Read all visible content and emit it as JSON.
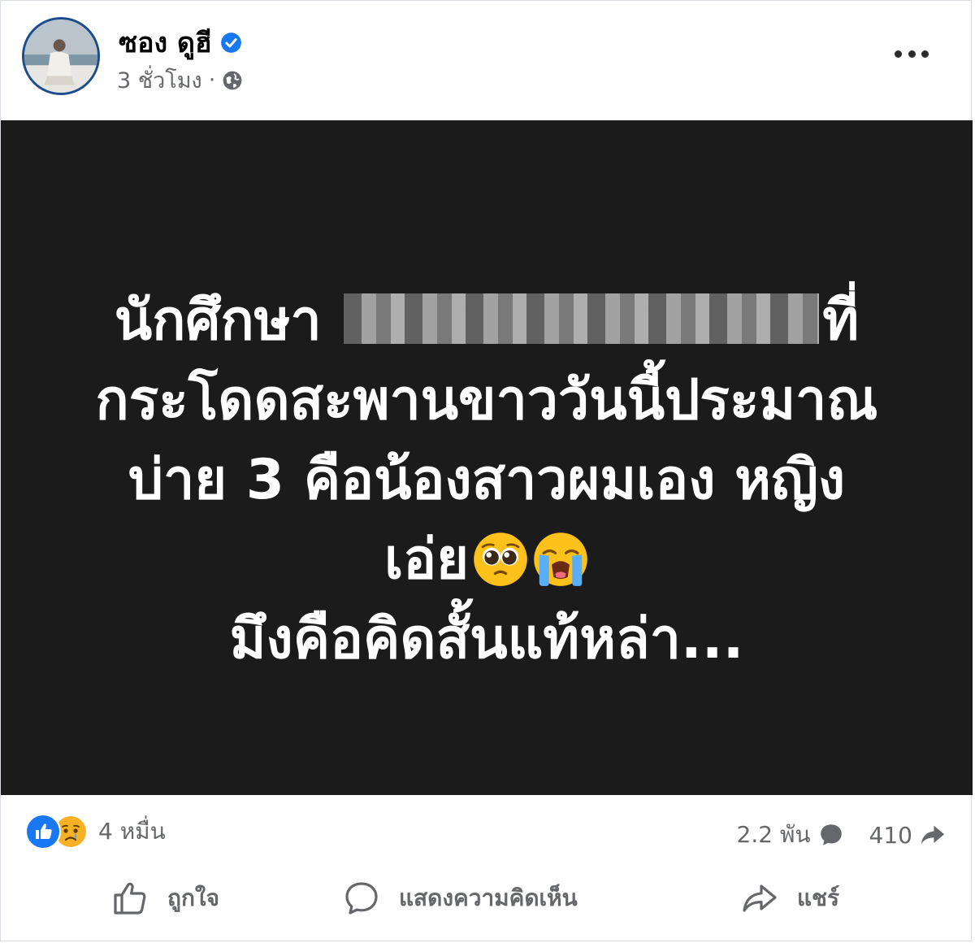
{
  "post": {
    "author": "ซอง ดูฮี",
    "verified": true,
    "time": "3 ชั่วโมง",
    "separator": "·",
    "privacy_icon": "globe-icon",
    "more_icon": "more-options-icon"
  },
  "image": {
    "line1": "นักศึกษา",
    "line1_end": "ที่",
    "line2": "กระโดดสะพานขาววันนี้ประมาณ",
    "line3": "บ่าย 3 คือน้องสาวผมเอง หญิง",
    "line4": "เอ่ย",
    "line5": "มึงคือคิดสั้นแท้หล่า...",
    "emojis": [
      "pleading-face-emoji",
      "loudly-crying-face-emoji"
    ],
    "background": "#1b1b1b"
  },
  "reactions": {
    "icons": [
      "like-reaction-icon",
      "sad-reaction-icon"
    ],
    "count": "4 หมื่น",
    "comments": "2.2 พัน",
    "shares": "410"
  },
  "actions": {
    "like": "ถูกใจ",
    "comment": "แสดงความคิดเห็น",
    "share": "แชร์"
  },
  "colors": {
    "accent": "#1877f2",
    "secondary_text": "#65676b",
    "sad": "#f7b125"
  }
}
